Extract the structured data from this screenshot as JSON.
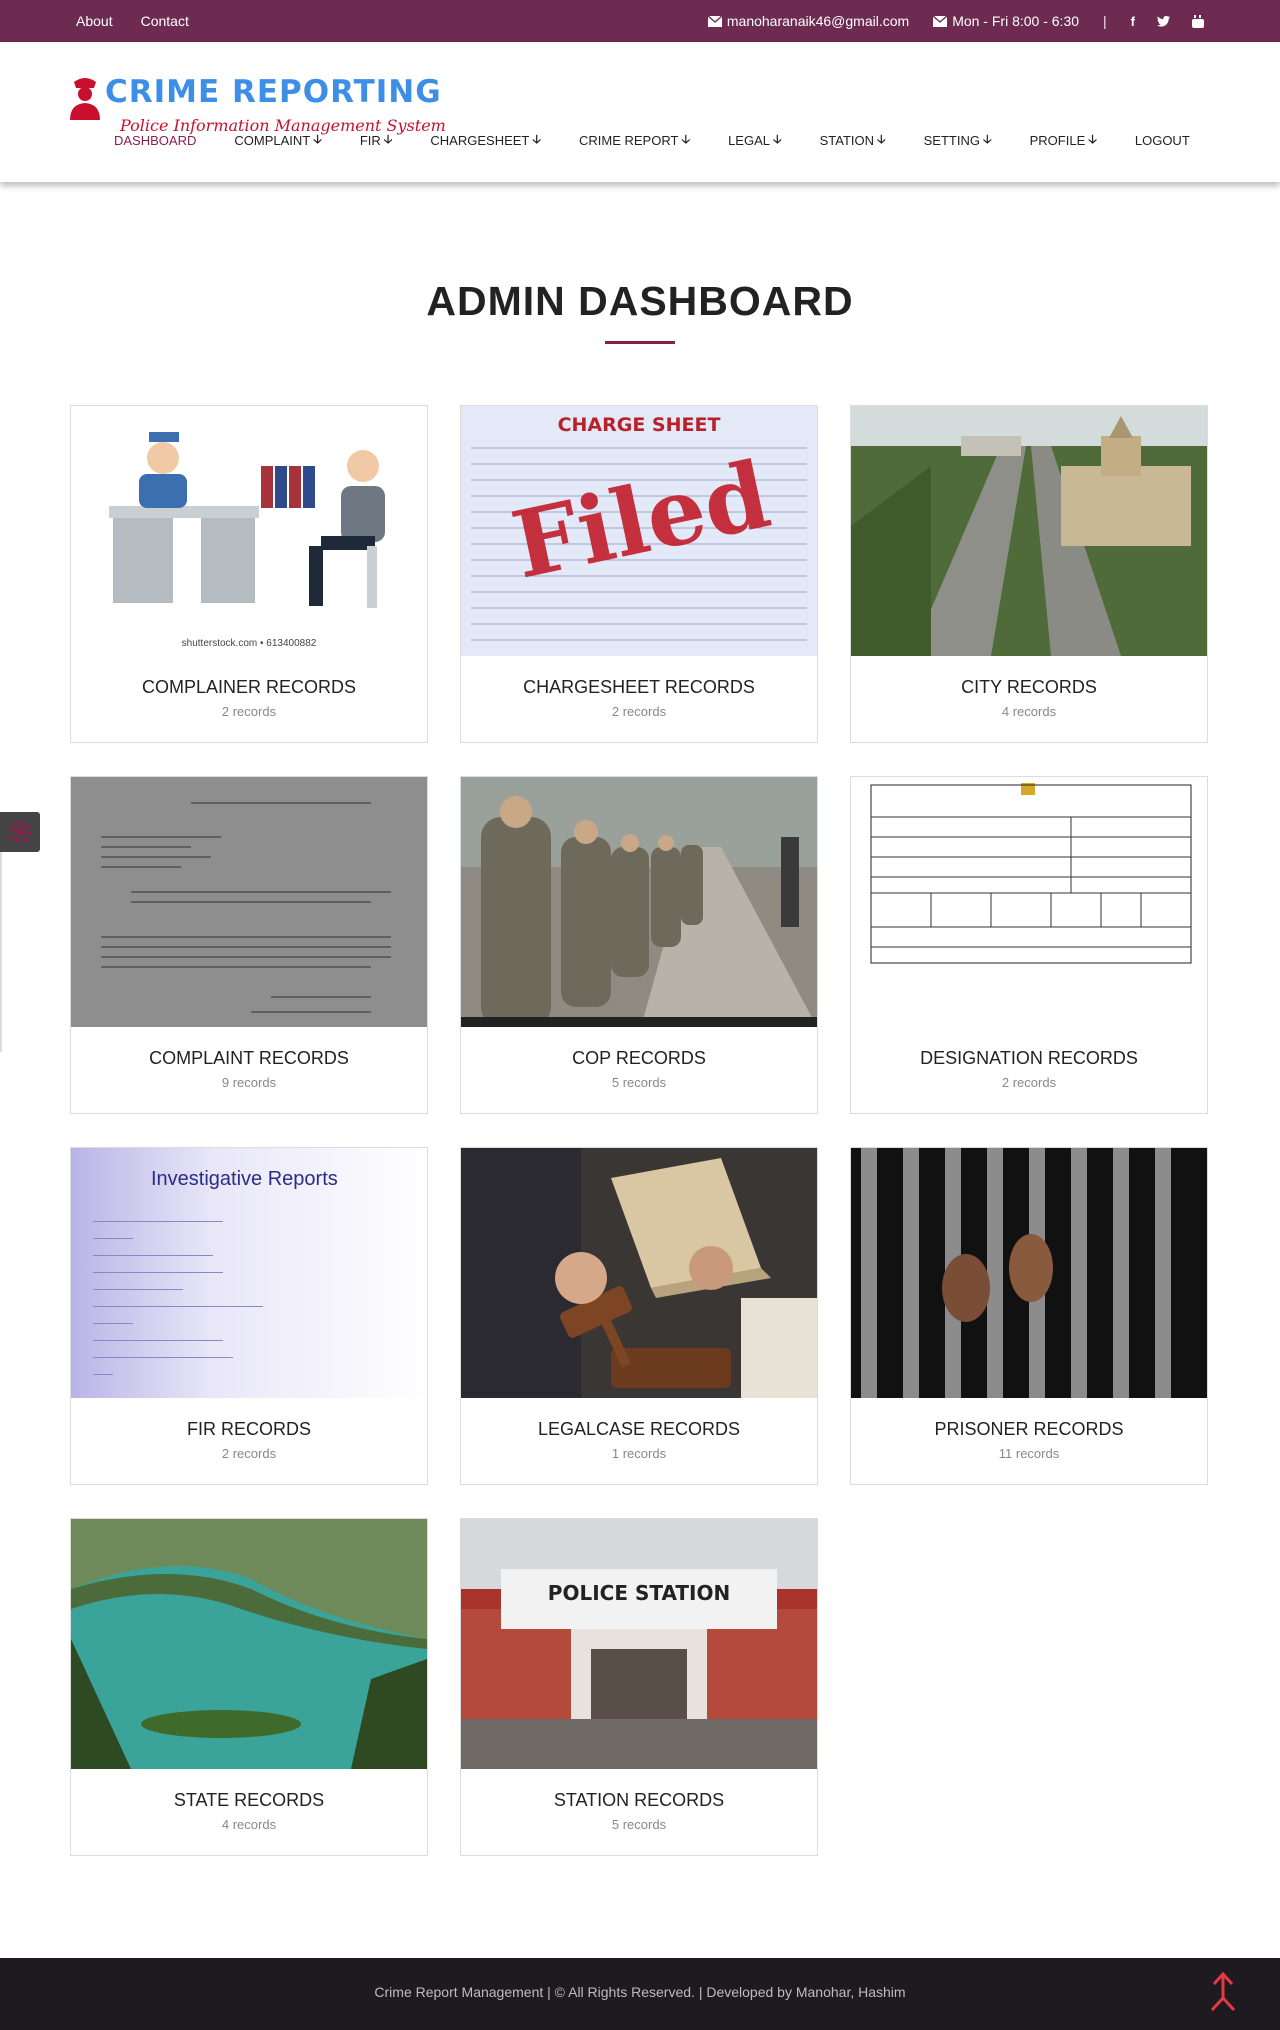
{
  "topbar": {
    "links": [
      "About",
      "Contact"
    ],
    "email": "manoharanaik46@gmail.com",
    "hours": "Mon - Fri 8:00 - 6:30",
    "separator": "|",
    "social": [
      "f",
      "t",
      "yt"
    ]
  },
  "logo": {
    "title": "CRIME REPORTING",
    "subtitle": "Police Information Management System"
  },
  "nav": [
    {
      "label": "DASHBOARD",
      "dropdown": false
    },
    {
      "label": "COMPLAINT",
      "dropdown": true
    },
    {
      "label": "FIR",
      "dropdown": true
    },
    {
      "label": "CHARGESHEET",
      "dropdown": true
    },
    {
      "label": "CRIME REPORT",
      "dropdown": true
    },
    {
      "label": "LEGAL",
      "dropdown": true
    },
    {
      "label": "STATION",
      "dropdown": true
    },
    {
      "label": "SETTING",
      "dropdown": true
    },
    {
      "label": "PROFILE",
      "dropdown": true
    },
    {
      "label": "LOGOUT",
      "dropdown": false
    }
  ],
  "page_title": "ADMIN DASHBOARD",
  "cards": [
    {
      "title": "COMPLAINER RECORDS",
      "count": "2 records",
      "image_caption": "shutterstock.com • 613400882"
    },
    {
      "title": "CHARGESHEET RECORDS",
      "count": "2 records",
      "image_heading": "CHARGE SHEET",
      "image_stamp": "Filed"
    },
    {
      "title": "CITY RECORDS",
      "count": "4 records"
    },
    {
      "title": "COMPLAINT RECORDS",
      "count": "9 records"
    },
    {
      "title": "COP RECORDS",
      "count": "5 records"
    },
    {
      "title": "DESIGNATION RECORDS",
      "count": "2 records"
    },
    {
      "title": "FIR RECORDS",
      "count": "2 records",
      "image_heading": "Investigative Reports"
    },
    {
      "title": "LEGALCASE RECORDS",
      "count": "1 records"
    },
    {
      "title": "PRISONER RECORDS",
      "count": "11 records"
    },
    {
      "title": "STATE RECORDS",
      "count": "4 records"
    },
    {
      "title": "STATION RECORDS",
      "count": "5 records",
      "image_heading": "POLICE STATION"
    }
  ],
  "footer": {
    "text": "Crime Report Management | © All Rights Reserved. | Developed by Manohar, Hashim"
  },
  "colors": {
    "topbar": "#6e2b52",
    "accent": "#8b1e4a",
    "logo_blue": "#3d8ee6",
    "logo_red": "#c8102e",
    "footer": "#1f1a1f"
  }
}
